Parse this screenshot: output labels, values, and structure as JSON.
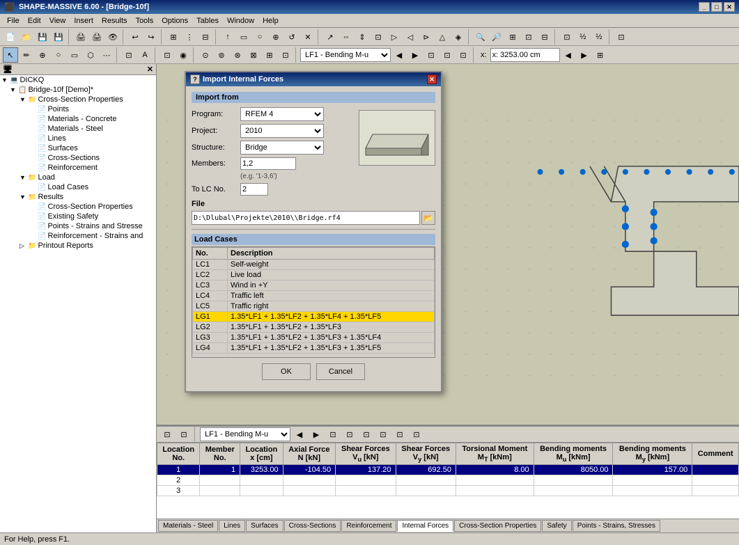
{
  "app": {
    "title": "SHAPE-MASSIVE 6.00 - [Bridge-10f]",
    "menu": [
      "File",
      "Edit",
      "View",
      "Insert",
      "Results",
      "Tools",
      "Options",
      "Tables",
      "Window",
      "Help"
    ]
  },
  "toolbar": {
    "lc_dropdown": "LF1 - Bending M-u",
    "coord_label": "x: 3253.00 cm"
  },
  "tree": {
    "root": "DICKQ",
    "project": "Bridge-10f [Demo]*",
    "nodes": [
      {
        "label": "Cross-Section Properties",
        "level": 2,
        "expand": true
      },
      {
        "label": "Points",
        "level": 3
      },
      {
        "label": "Materials - Concrete",
        "level": 3
      },
      {
        "label": "Materials - Steel",
        "level": 3
      },
      {
        "label": "Lines",
        "level": 3
      },
      {
        "label": "Surfaces",
        "level": 3
      },
      {
        "label": "Cross-Sections",
        "level": 3
      },
      {
        "label": "Reinforcement",
        "level": 3
      },
      {
        "label": "Load",
        "level": 2,
        "expand": true
      },
      {
        "label": "Load Cases",
        "level": 3
      },
      {
        "label": "Results",
        "level": 2,
        "expand": true
      },
      {
        "label": "Cross-Section Properties",
        "level": 3
      },
      {
        "label": "Existing Safety",
        "level": 3
      },
      {
        "label": "Points - Strains and Stresse",
        "level": 3
      },
      {
        "label": "Reinforcement - Strains and",
        "level": 3
      },
      {
        "label": "Printout Reports",
        "level": 2
      }
    ]
  },
  "dialog": {
    "title": "Import Internal Forces",
    "import_from_label": "Import from",
    "program_label": "Program:",
    "program_value": "RFEM 4",
    "project_label": "Project:",
    "project_value": "2010",
    "structure_label": "Structure:",
    "structure_value": "Bridge",
    "members_label": "Members:",
    "members_value": "1,2",
    "hint": "(e.g. '1-3,6')",
    "tolc_label": "To LC No.",
    "tolc_value": "2",
    "file_label": "File",
    "file_value": "D:\\Dlubal\\Projekte\\2010\\\\Bridge.rf4",
    "load_cases_label": "Load Cases",
    "lc_columns": [
      "No.",
      "Description"
    ],
    "load_cases": [
      {
        "no": "LC1",
        "desc": "Self-weight",
        "selected": false
      },
      {
        "no": "LC2",
        "desc": "Live load",
        "selected": false
      },
      {
        "no": "LC3",
        "desc": "Wind in +Y",
        "selected": false
      },
      {
        "no": "LC4",
        "desc": "Traffic left",
        "selected": false
      },
      {
        "no": "LC5",
        "desc": "Traffic right",
        "selected": false
      },
      {
        "no": "LG1",
        "desc": "1.35*LF1 + 1.35*LF2 + 1.35*LF4 + 1.35*LF5",
        "selected": true
      },
      {
        "no": "LG2",
        "desc": "1.35*LF1 + 1.35*LF2 + 1.35*LF3",
        "selected": false
      },
      {
        "no": "LG3",
        "desc": "1.35*LF1 + 1.35*LF2 + 1.35*LF3 + 1.35*LF4",
        "selected": false
      },
      {
        "no": "LG4",
        "desc": "1.35*LF1 + 1.35*LF2 + 1.35*LF3 + 1.35*LF5",
        "selected": false
      }
    ],
    "ok_label": "OK",
    "cancel_label": "Cancel",
    "help_icon": "?"
  },
  "bottom_tabs": [
    "Materials - Steel",
    "Lines",
    "Surfaces",
    "Cross-Sections",
    "Reinforcement",
    "Internal Forces",
    "Cross-Section Properties",
    "Safety",
    "Points - Strains, Stresses"
  ],
  "active_tab": "Internal Forces",
  "data_table": {
    "columns": [
      "Location No.",
      "Member No.",
      "Location x [cm]",
      "Axial Force N [kN]",
      "Shear Forces Vu [kN]",
      "Shear Forces Vy [kN]",
      "Torsional Moment MT [kNm]",
      "Bending moments Mu [kNm]",
      "Bending moments My [kNm]",
      "Comment"
    ],
    "rows": [
      {
        "loc": "1",
        "member": "1",
        "x": "3253.00",
        "N": "-104.50",
        "Vu": "137.20",
        "Vy": "692.50",
        "MT": "8.00",
        "Mu": "8050.00",
        "My": "157.00",
        "comment": "",
        "selected": true
      },
      {
        "loc": "2",
        "member": "",
        "x": "",
        "N": "",
        "Vu": "",
        "Vy": "",
        "MT": "",
        "Mu": "",
        "My": "",
        "comment": "",
        "selected": false
      },
      {
        "loc": "3",
        "member": "",
        "x": "",
        "N": "",
        "Vu": "",
        "Vy": "",
        "MT": "",
        "Mu": "",
        "My": "",
        "comment": "",
        "selected": false
      }
    ]
  },
  "status_bar": {
    "text": "For Help, press F1."
  },
  "bottom_toolbar": {
    "lc_dropdown": "LF1 - Bending M-u"
  }
}
